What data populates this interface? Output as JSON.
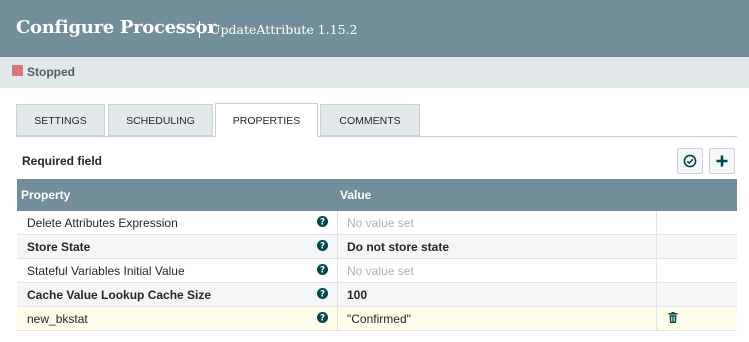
{
  "header": {
    "title": "Configure Processor",
    "subtitle": "UpdateAttribute 1.15.2"
  },
  "status": {
    "label": "Stopped",
    "color": "#d7787f"
  },
  "tabs": [
    {
      "label": "SETTINGS",
      "active": false
    },
    {
      "label": "SCHEDULING",
      "active": false
    },
    {
      "label": "PROPERTIES",
      "active": true
    },
    {
      "label": "COMMENTS",
      "active": false
    }
  ],
  "properties_panel": {
    "required_label": "Required field",
    "actions": [
      "verify-icon",
      "add-property-icon"
    ]
  },
  "table": {
    "columns": [
      "Property",
      "Value"
    ],
    "rows": [
      {
        "name": "Delete Attributes Expression",
        "value": "No value set",
        "required": false,
        "empty": true
      },
      {
        "name": "Store State",
        "value": "Do not store state",
        "required": true,
        "empty": false
      },
      {
        "name": "Stateful Variables Initial Value",
        "value": "No value set",
        "required": false,
        "empty": true
      },
      {
        "name": "Cache Value Lookup Cache Size",
        "value": "100",
        "required": true,
        "empty": false
      },
      {
        "name": "new_bkstat",
        "value": "\"Confirmed\"",
        "required": false,
        "empty": false,
        "user_defined": true
      }
    ]
  },
  "colors": {
    "header_bg": "#728e9b",
    "status_bg": "#e3e8eb",
    "highlight_row": "#fffce9"
  }
}
